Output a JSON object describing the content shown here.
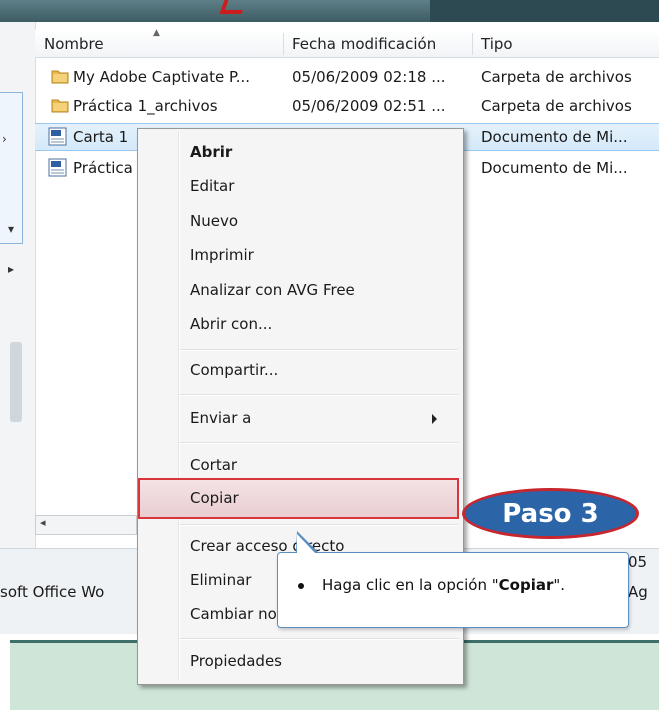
{
  "columns": {
    "name": "Nombre",
    "date": "Fecha modificación",
    "type": "Tipo"
  },
  "files": [
    {
      "name": "My Adobe Captivate P...",
      "date": "05/06/2009 02:18 ...",
      "type": "Carpeta de archivos",
      "icon": "folder-icon"
    },
    {
      "name": "Práctica 1_archivos",
      "date": "05/06/2009 02:51 ...",
      "type": "Carpeta de archivos",
      "icon": "folder-icon"
    },
    {
      "name": "Carta 1",
      "date": "",
      "type": "Documento de Mi...",
      "icon": "word-doc-icon",
      "selected": true
    },
    {
      "name": "Práctica",
      "date": "",
      "type": "Documento de Mi...",
      "icon": "word-doc-icon"
    }
  ],
  "context_menu": {
    "open": "Abrir",
    "edit": "Editar",
    "new": "Nuevo",
    "print": "Imprimir",
    "avg": "Analizar con AVG Free",
    "open_with": "Abrir con...",
    "share": "Compartir...",
    "send_to": "Enviar a",
    "cut": "Cortar",
    "copy": "Copiar",
    "shortcut": "Crear acceso directo",
    "delete": "Eliminar",
    "rename": "Cambiar nombre",
    "properties": "Propiedades"
  },
  "badge": {
    "label": "Paso 3"
  },
  "callout": {
    "prefix": "Haga clic en la opción \"",
    "bold": "Copiar",
    "suffix": "\"."
  },
  "details": {
    "left_text": "soft Office Wo",
    "right_date": "05",
    "right_text": "Ag"
  },
  "colors": {
    "highlight_border": "#d8353a",
    "badge_fill": "#2b65a8",
    "badge_border": "#c8262e"
  }
}
